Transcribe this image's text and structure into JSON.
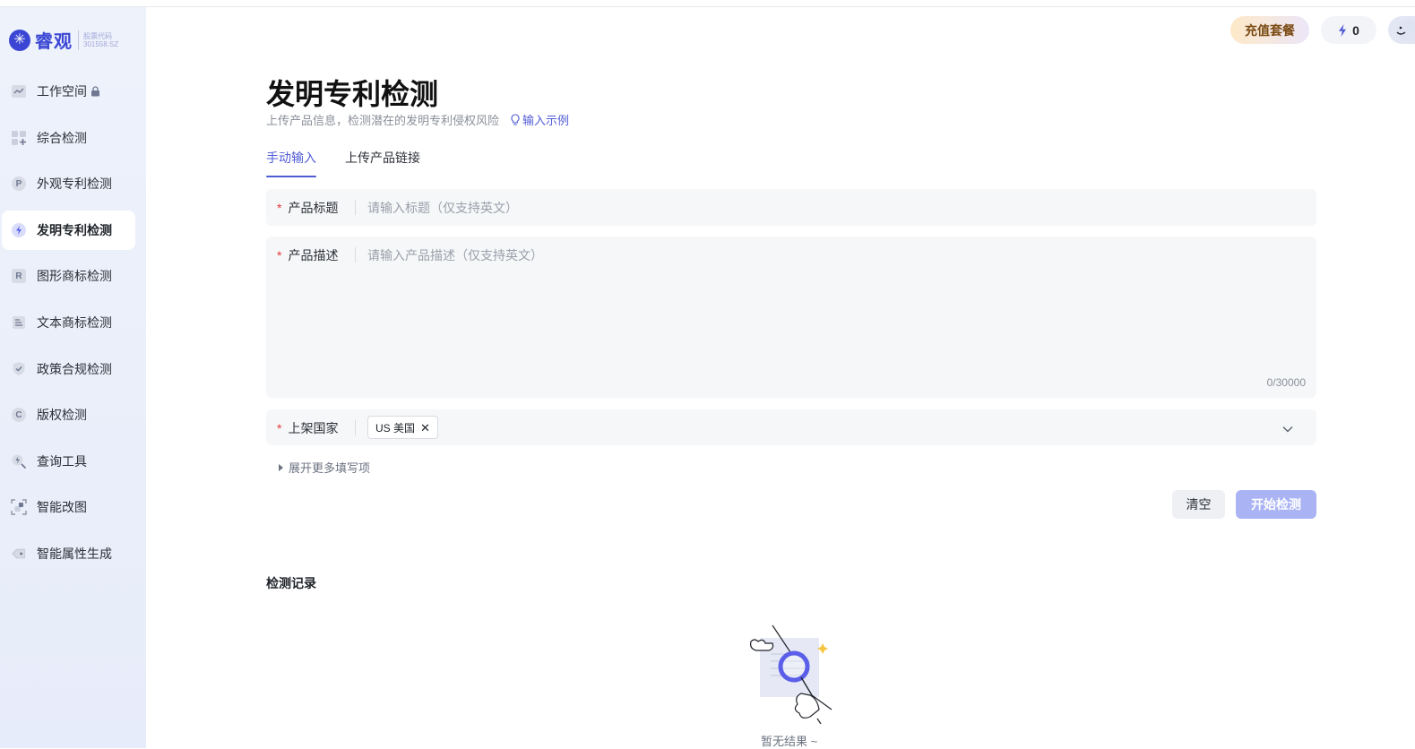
{
  "brand": {
    "name": "睿观",
    "stock_label": "股票代码",
    "stock_code": "301558.SZ"
  },
  "sidebar": {
    "items": [
      {
        "label": "工作空间",
        "icon": "line-chart-icon",
        "locked": true
      },
      {
        "label": "综合检测",
        "icon": "grid-plus-icon"
      },
      {
        "label": "外观专利检测",
        "icon": "p-badge-icon",
        "badge": "P"
      },
      {
        "label": "发明专利检测",
        "icon": "lightning-badge-icon",
        "active": true
      },
      {
        "label": "图形商标检测",
        "icon": "r-badge-icon",
        "badge": "R"
      },
      {
        "label": "文本商标检测",
        "icon": "text-doc-icon"
      },
      {
        "label": "政策合规检测",
        "icon": "shield-check-icon"
      },
      {
        "label": "版权检测",
        "icon": "c-badge-icon",
        "badge": "C"
      },
      {
        "label": "查询工具",
        "icon": "search-bolt-icon"
      },
      {
        "label": "智能改图",
        "icon": "image-edit-icon"
      },
      {
        "label": "智能属性生成",
        "icon": "tag-icon"
      }
    ]
  },
  "header": {
    "recharge_label": "充值套餐",
    "credits": "0"
  },
  "page": {
    "title": "发明专利检测",
    "subtitle": "上传产品信息，检测潜在的发明专利侵权风险",
    "example_link": "输入示例"
  },
  "tabs": [
    {
      "label": "手动输入",
      "active": true
    },
    {
      "label": "上传产品链接",
      "active": false
    }
  ],
  "form": {
    "title_label": "产品标题",
    "title_placeholder": "请输入标题（仅支持英文）",
    "title_value": "",
    "desc_label": "产品描述",
    "desc_placeholder": "请输入产品描述（仅支持英文）",
    "desc_value": "",
    "desc_counter": "0/30000",
    "country_label": "上架国家",
    "country_chip": "US 美国",
    "expand_label": "展开更多填写项"
  },
  "actions": {
    "clear_label": "清空",
    "start_label": "开始检测"
  },
  "records": {
    "title": "检测记录",
    "empty_text": "暂无结果 ~"
  },
  "colors": {
    "accent": "#4f5bd5",
    "brand": "#3b47d4",
    "start_button_disabled": "#aab3f3",
    "required": "#e5383b"
  }
}
